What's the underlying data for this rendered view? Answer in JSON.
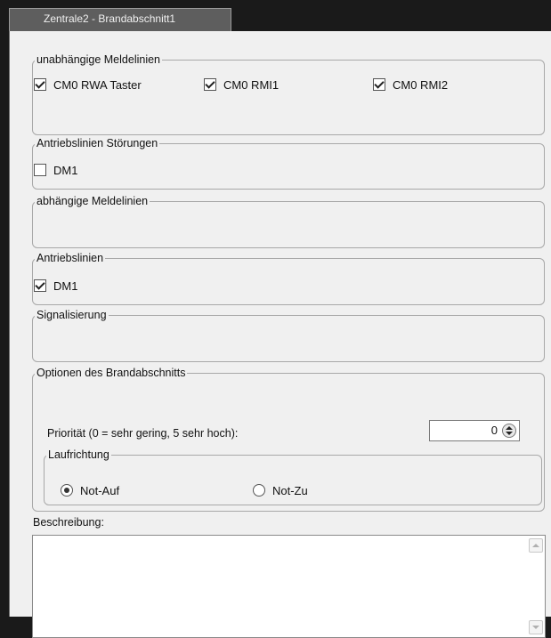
{
  "tab": {
    "title": "Zentrale2 - Brandabschnitt1"
  },
  "groups": {
    "independent": {
      "legend": "unabhängige Meldelinien",
      "items": [
        {
          "label": "CM0 RWA Taster",
          "checked": true
        },
        {
          "label": "CM0 RMI1",
          "checked": true
        },
        {
          "label": "CM0 RMI2",
          "checked": true
        }
      ]
    },
    "drive_faults": {
      "legend": "Antriebslinien Störungen",
      "items": [
        {
          "label": "DM1",
          "checked": false
        }
      ]
    },
    "dependent": {
      "legend": "abhängige Meldelinien"
    },
    "drive_lines": {
      "legend": "Antriebslinien",
      "items": [
        {
          "label": "DM1",
          "checked": true
        }
      ]
    },
    "signaling": {
      "legend": "Signalisierung"
    },
    "options": {
      "legend": "Optionen des Brandabschnitts",
      "priority_label": "Priorität (0 = sehr gering, 5 sehr hoch):",
      "priority_value": "0",
      "direction": {
        "legend": "Laufrichtung",
        "options": [
          {
            "label": "Not-Auf",
            "selected": true
          },
          {
            "label": "Not-Zu",
            "selected": false
          }
        ]
      }
    }
  },
  "description": {
    "label": "Beschreibung:",
    "value": ""
  }
}
